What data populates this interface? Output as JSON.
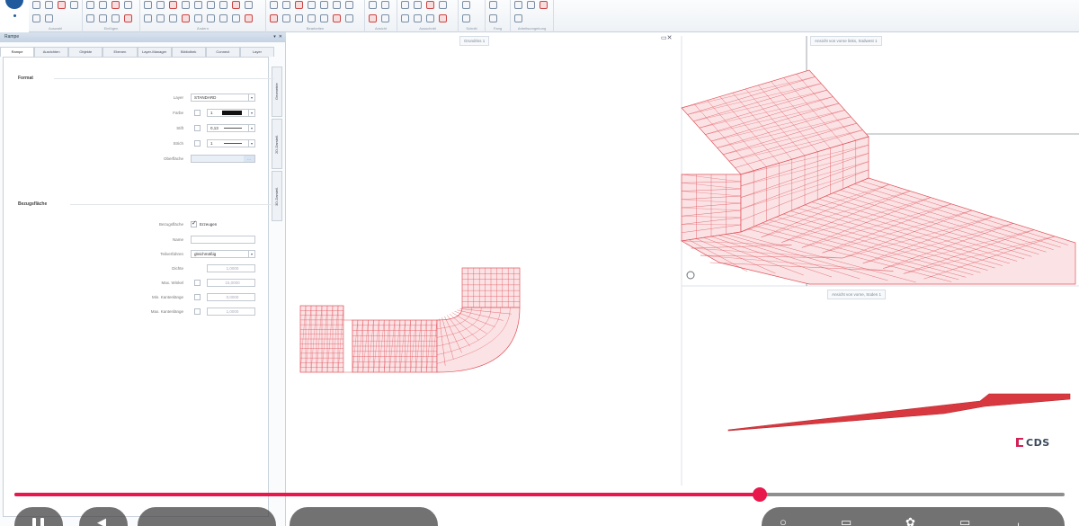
{
  "ribbon": {
    "groups": [
      {
        "label": "Auswahl"
      },
      {
        "label": "Einfügen"
      },
      {
        "label": "Ändern"
      },
      {
        "label": "Bearbeiten"
      },
      {
        "label": "Ansicht"
      },
      {
        "label": "Ausschnitt"
      },
      {
        "label": "Schnitt"
      },
      {
        "label": "Fang"
      },
      {
        "label": "Arbeitsumgebung"
      }
    ]
  },
  "panel": {
    "title": "Rampe",
    "controls": [
      "▾",
      "✕"
    ],
    "tabs": [
      "Rampe",
      "Ausrichten",
      "Objekte",
      "Ebenen",
      "Layer-Manager",
      "Bibliothek",
      "Connect",
      "Layer"
    ],
    "side_tabs": [
      "Geometrie",
      "2D-Darstell.",
      "3D-Darstell."
    ],
    "sections": {
      "format": {
        "title": "Format",
        "rows": [
          {
            "label": "Layer",
            "value": "STANDARD",
            "type": "select"
          },
          {
            "label": "Farbe",
            "value": "1",
            "type": "color"
          },
          {
            "label": "Stift",
            "value": "0,13",
            "type": "line"
          },
          {
            "label": "Strich",
            "value": "1",
            "type": "line"
          },
          {
            "label": "Oberfläche",
            "value": "",
            "type": "button"
          }
        ]
      },
      "reference": {
        "title": "Bezugsfläche",
        "rows": [
          {
            "label": "Bezugsfläche",
            "value": "Erzeugen",
            "type": "checkbox",
            "checked": true
          },
          {
            "label": "Name",
            "value": "",
            "type": "text"
          },
          {
            "label": "Teilverfahren",
            "value": "gleichmäßig",
            "type": "select"
          },
          {
            "label": "Dichte",
            "value": "1,0000",
            "type": "disabled"
          },
          {
            "label": "Max. Winkel",
            "value": "15,0000",
            "type": "disabled-cb"
          },
          {
            "label": "Min. Kantenlänge",
            "value": "0,0000",
            "type": "disabled-cb"
          },
          {
            "label": "Max. Kantenlänge",
            "value": "1,0000",
            "type": "disabled-cb"
          }
        ]
      }
    }
  },
  "viewports": {
    "plan": {
      "title": "Grundriss 1",
      "controls": "▭✕"
    },
    "iso": {
      "title": "Ansicht von vorne links, Südwest 1"
    },
    "front": {
      "title": "Ansicht von vorne, Süden 1"
    }
  },
  "brand": {
    "logo_text": "CDS",
    "accent": "#d22257"
  },
  "player": {
    "progress": 0.71,
    "colors": {
      "played": "#e8174c",
      "track": "#8e8e8e"
    },
    "icons": [
      "pause-icon",
      "volume-icon",
      "fullscreen-icon",
      "settings-icon"
    ]
  },
  "colors": {
    "mesh": "#e0525a",
    "mesh_fill": "#fbe3e5"
  }
}
